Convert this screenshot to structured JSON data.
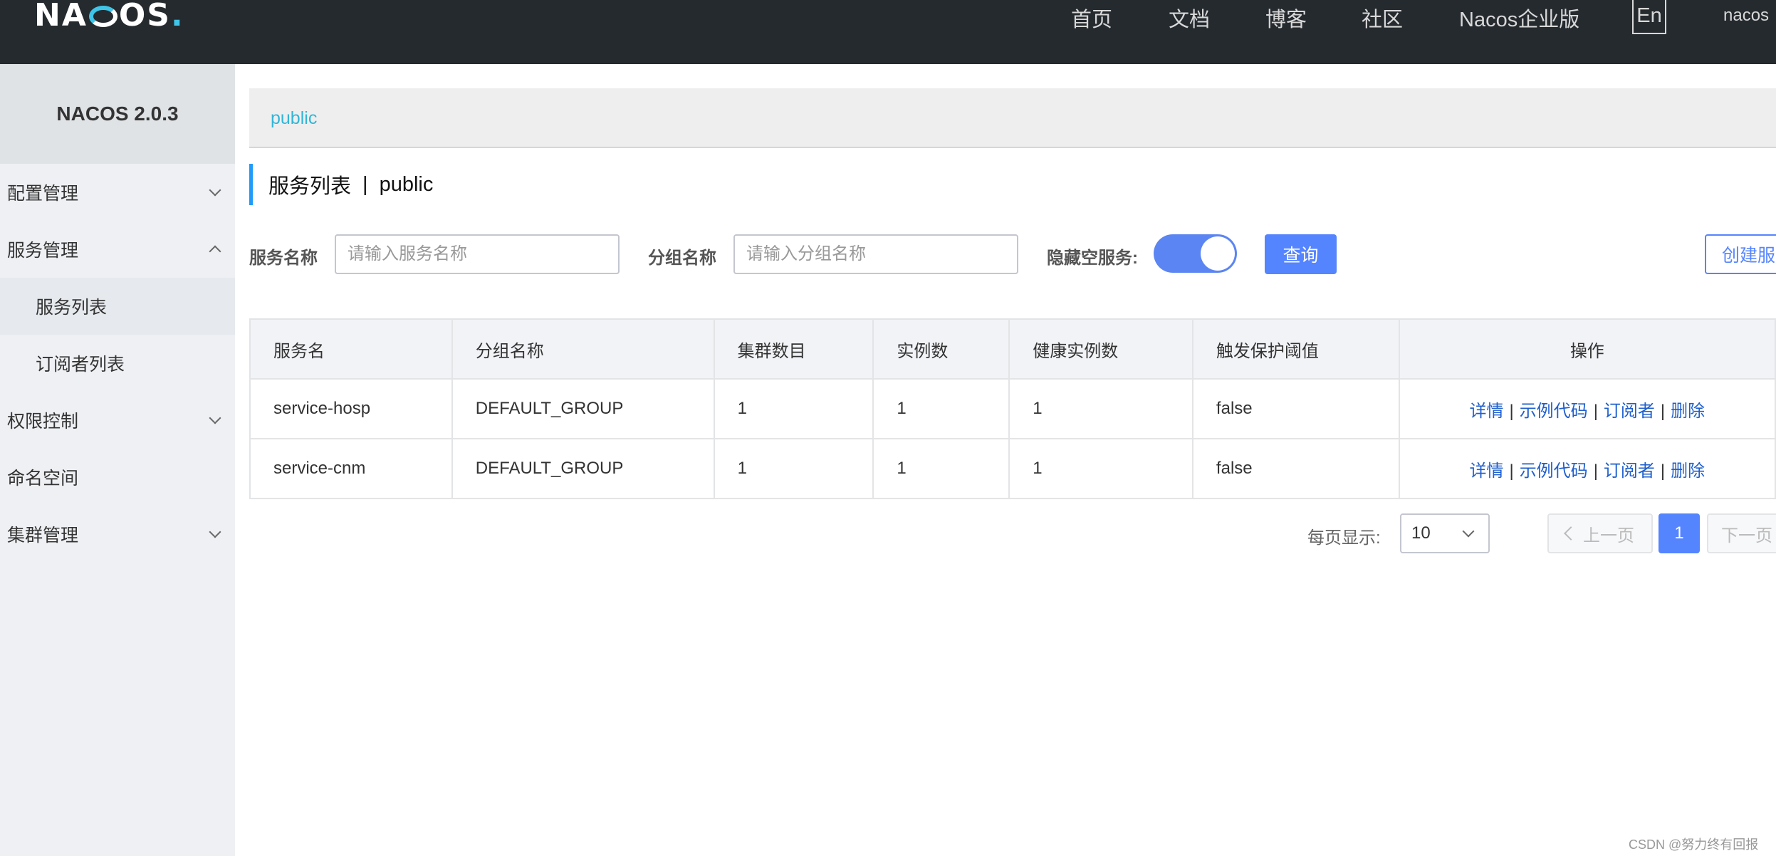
{
  "header": {
    "logo": "NACOS.",
    "nav": [
      "首页",
      "文档",
      "博客",
      "社区",
      "Nacos企业版"
    ],
    "lang": "En",
    "user": "nacos"
  },
  "sidebar": {
    "brand": "NACOS 2.0.3",
    "items": [
      {
        "label": "配置管理",
        "chevron": "down"
      },
      {
        "label": "服务管理",
        "chevron": "up"
      },
      {
        "label": "服务列表",
        "active": true
      },
      {
        "label": "订阅者列表"
      },
      {
        "label": "权限控制",
        "chevron": "down"
      },
      {
        "label": "命名空间"
      },
      {
        "label": "集群管理",
        "chevron": "down"
      }
    ]
  },
  "namespace": {
    "current": "public"
  },
  "page": {
    "title": "服务列表",
    "separator": "|",
    "namespace": "public"
  },
  "filters": {
    "service_label": "服务名称",
    "service_placeholder": "请输入服务名称",
    "group_label": "分组名称",
    "group_placeholder": "请输入分组名称",
    "hide_empty_label": "隐藏空服务:",
    "hide_empty_on": true,
    "query_button": "查询",
    "create_button": "创建服"
  },
  "table": {
    "columns": [
      "服务名",
      "分组名称",
      "集群数目",
      "实例数",
      "健康实例数",
      "触发保护阈值",
      "操作"
    ],
    "rows": [
      {
        "name": "service-hosp",
        "group": "DEFAULT_GROUP",
        "clusters": "1",
        "instances": "1",
        "healthy": "1",
        "threshold": "false"
      },
      {
        "name": "service-cnm",
        "group": "DEFAULT_GROUP",
        "clusters": "1",
        "instances": "1",
        "healthy": "1",
        "threshold": "false"
      }
    ],
    "actions": {
      "detail": "详情",
      "sample": "示例代码",
      "subscriber": "订阅者",
      "delete": "删除",
      "sep": "|"
    }
  },
  "pagination": {
    "page_size_label": "每页显示:",
    "page_size": "10",
    "prev": "上一页",
    "current": "1",
    "next": "下一页"
  },
  "watermark": "CSDN @努力终有回报",
  "colors": {
    "accent": "#5584ff",
    "topbar": "#252a2f",
    "link": "#1f5fcc",
    "ns": "#33b5d7"
  }
}
